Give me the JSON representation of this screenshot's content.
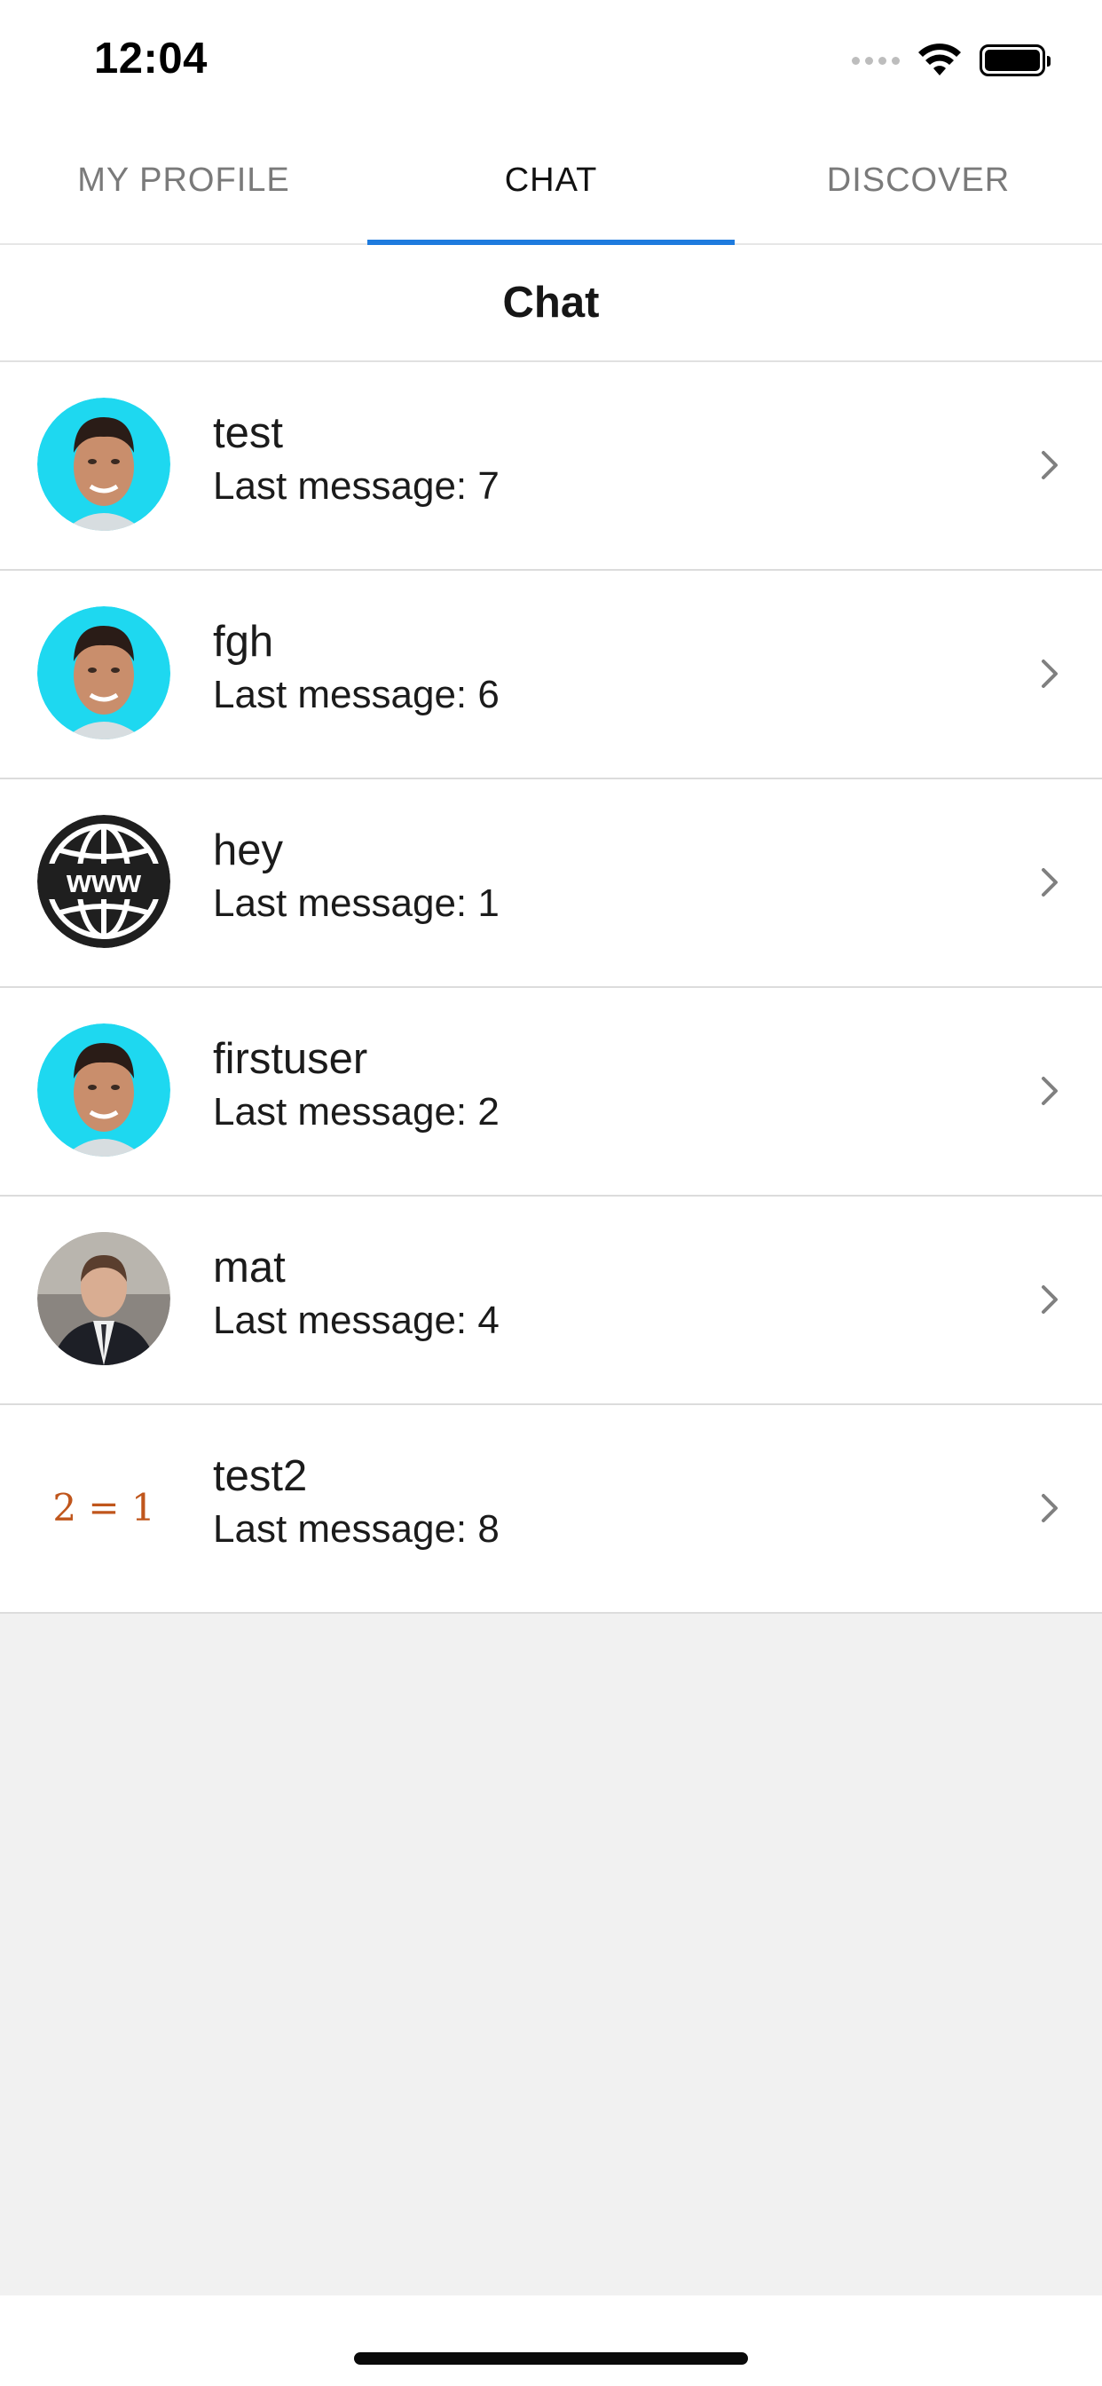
{
  "status_bar": {
    "time": "12:04"
  },
  "tabs": [
    {
      "label": "MY PROFILE",
      "active": false
    },
    {
      "label": "CHAT",
      "active": true
    },
    {
      "label": "DISCOVER",
      "active": false
    }
  ],
  "colors": {
    "accent": "#1e7bde",
    "avatar_bg_cyan": "#1ed8f0",
    "list_background": "#f1f1f1",
    "math_text": "#c0561c"
  },
  "header": {
    "title": "Chat"
  },
  "chats": [
    {
      "name": "test",
      "last_message": "Last message: 7",
      "avatar": "face-avatar"
    },
    {
      "name": "fgh",
      "last_message": "Last message: 6",
      "avatar": "face-avatar"
    },
    {
      "name": "hey",
      "last_message": "Last message: 1",
      "avatar": "globe-www-icon"
    },
    {
      "name": "firstuser",
      "last_message": "Last message: 2",
      "avatar": "face-avatar"
    },
    {
      "name": "mat",
      "last_message": "Last message: 4",
      "avatar": "photo-avatar"
    },
    {
      "name": "test2",
      "last_message": "Last message: 8",
      "avatar_text": "2 = 1"
    }
  ],
  "globe_label": "www"
}
